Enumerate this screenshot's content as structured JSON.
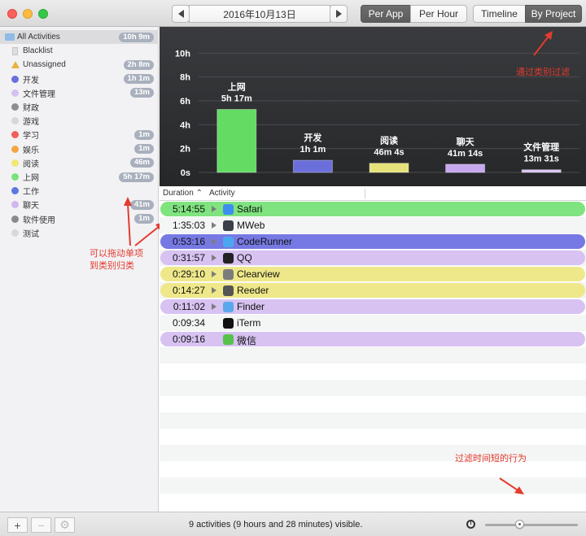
{
  "toolbar": {
    "date": "2016年10月13日",
    "per_app": "Per App",
    "per_hour": "Per Hour",
    "timeline": "Timeline",
    "by_project": "By Project"
  },
  "sidebar": {
    "items": [
      {
        "label": "All Activities",
        "badge": "10h 9m",
        "icon": "folder-icon",
        "color": "#8fbbe6"
      },
      {
        "label": "Blacklist",
        "badge": "",
        "icon": "document-icon",
        "color": "#dedede"
      },
      {
        "label": "Unassigned",
        "badge": "2h 8m",
        "icon": "warning-icon",
        "color": "#e7b341"
      },
      {
        "label": "开发",
        "badge": "1h 1m",
        "icon": "dot-icon",
        "color": "#6b6fdb"
      },
      {
        "label": "文件管理",
        "badge": "13m",
        "icon": "dot-icon",
        "color": "#d4c1f0"
      },
      {
        "label": "财政",
        "badge": "",
        "icon": "dot-icon",
        "color": "#8e8e8e"
      },
      {
        "label": "游戏",
        "badge": "",
        "icon": "dot-icon",
        "color": "#d6d6d6"
      },
      {
        "label": "学习",
        "badge": "1m",
        "icon": "dot-icon",
        "color": "#f0605a"
      },
      {
        "label": "娱乐",
        "badge": "1m",
        "icon": "dot-icon",
        "color": "#f4a543"
      },
      {
        "label": "阅读",
        "badge": "46m",
        "icon": "dot-icon",
        "color": "#f1e873"
      },
      {
        "label": "上网",
        "badge": "5h 17m",
        "icon": "dot-icon",
        "color": "#79e27a"
      },
      {
        "label": "工作",
        "badge": "",
        "icon": "dot-icon",
        "color": "#5b78e0"
      },
      {
        "label": "聊天",
        "badge": "41m",
        "icon": "dot-icon",
        "color": "#d3b6ee"
      },
      {
        "label": "软件使用",
        "badge": "1m",
        "icon": "dot-icon",
        "color": "#8a8a8a"
      },
      {
        "label": "测试",
        "badge": "",
        "icon": "dot-icon",
        "color": "#d8d8d8"
      }
    ]
  },
  "annotations": {
    "filter_by_category": "通过类别过滤",
    "drag_line1": "可以拖动单项",
    "drag_line2": "到类别归类",
    "filter_short": "过滤时间短的行为"
  },
  "chart_data": {
    "type": "bar",
    "categories": [
      "上网",
      "开发",
      "阅读",
      "聊天",
      "文件管理"
    ],
    "values": [
      5.283,
      1.017,
      0.768,
      0.687,
      0.225
    ],
    "value_labels": [
      "5h 17m",
      "1h 1m",
      "46m 4s",
      "41m 14s",
      "13m 31s"
    ],
    "colors": [
      "#64dc64",
      "#6a6fdc",
      "#e6e27a",
      "#c6a8ee",
      "#d9c4f3"
    ],
    "yticks": [
      "0s",
      "2h",
      "4h",
      "6h",
      "8h",
      "10h"
    ],
    "ylim": [
      0,
      10.5
    ],
    "grid": true
  },
  "table": {
    "col_duration": "Duration",
    "col_activity": "Activity",
    "rows": [
      {
        "duration": "5:14:55",
        "app": "Safari",
        "color": "#7fe37f",
        "icon_color": "#3d8ef0",
        "expandable": true
      },
      {
        "duration": "1:35:03",
        "app": "MWeb",
        "color": "",
        "icon_color": "#3b3f47",
        "expandable": true
      },
      {
        "duration": "0:53:16",
        "app": "CodeRunner",
        "color": "#7679e3",
        "icon_color": "#4aa8f0",
        "expandable": true
      },
      {
        "duration": "0:31:57",
        "app": "QQ",
        "color": "#d7c2f1",
        "icon_color": "#222222",
        "expandable": true
      },
      {
        "duration": "0:29:10",
        "app": "Clearview",
        "color": "#efe88a",
        "icon_color": "#7c7c7c",
        "expandable": true
      },
      {
        "duration": "0:14:27",
        "app": "Reeder",
        "color": "#efe88a",
        "icon_color": "#555555",
        "expandable": true
      },
      {
        "duration": "0:11:02",
        "app": "Finder",
        "color": "#d7c2f1",
        "icon_color": "#5aa7ec",
        "expandable": true
      },
      {
        "duration": "0:09:34",
        "app": "iTerm",
        "color": "",
        "icon_color": "#111111",
        "expandable": false
      },
      {
        "duration": "0:09:16",
        "app": "微信",
        "color": "#d7c2f1",
        "icon_color": "#56c24a",
        "expandable": false
      }
    ]
  },
  "status": {
    "text": "9 activities (9 hours and 28 minutes) visible.",
    "add": "+",
    "remove": "−",
    "gear": "⚙"
  }
}
